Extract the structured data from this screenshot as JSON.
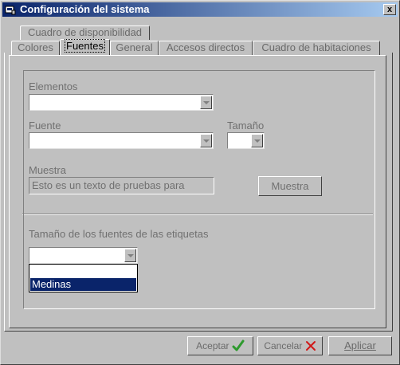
{
  "window": {
    "title": "Configuración del sistema",
    "close_glyph": "x"
  },
  "tabs_back": [
    {
      "label": "Cuadro de disponibilidad"
    }
  ],
  "tabs_front": [
    {
      "label": "Colores",
      "active": false
    },
    {
      "label": "Fuentes",
      "active": true
    },
    {
      "label": "General",
      "active": false
    },
    {
      "label": "Accesos directos",
      "active": false
    },
    {
      "label": "Cuadro de habitaciones",
      "active": false
    }
  ],
  "fonts_tab": {
    "elements_label": "Elementos",
    "font_label": "Fuente",
    "size_label": "Tamaño",
    "sample_label": "Muestra",
    "sample_text": "Esto es un texto de pruebas para",
    "sample_button": "Muestra",
    "label_size_title": "Tamaño de los fuentes de las etiquetas",
    "label_size_options": [
      "",
      "Medinas"
    ],
    "label_size_selected": "Medinas"
  },
  "footer": {
    "accept_label": "Aceptar",
    "cancel_label": "Cancelar",
    "apply_label": "Aplicar"
  },
  "icons": {
    "accept": "green-check-icon",
    "cancel": "red-x-icon"
  },
  "colors": {
    "title_start": "#0a246a",
    "title_end": "#a6caf0",
    "selection": "#0a246a"
  }
}
